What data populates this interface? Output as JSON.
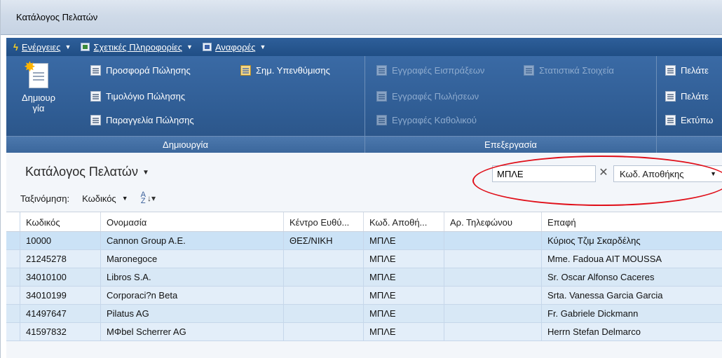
{
  "window": {
    "title": "Κατάλογος Πελατών"
  },
  "menubar": {
    "items": [
      {
        "label": "Ενέργειες",
        "icon": "lightning-icon"
      },
      {
        "label": "Σχετικές Πληροφορίες",
        "icon": "related-info-icon"
      },
      {
        "label": "Αναφορές",
        "icon": "reports-icon"
      }
    ]
  },
  "ribbon": {
    "create_group": {
      "label": "Δημιουργία",
      "new_button": "Δημιουργία",
      "items": [
        "Προσφορά Πώλησης",
        "Τιμολόγιο Πώλησης",
        "Παραγγελία Πώλησης",
        "Σημ. Υπενθύμισης"
      ]
    },
    "process_group": {
      "label": "Επεξεργασία",
      "items": [
        "Εγγραφές Εισπράξεων",
        "Εγγραφές Πωλήσεων",
        "Εγγραφές Καθολικού",
        "Στατιστικά Στοιχεία"
      ]
    },
    "report_group": {
      "items": [
        "Πελάτε",
        "Πελάτε",
        "Εκτύπω"
      ]
    }
  },
  "page": {
    "title": "Κατάλογος Πελατών",
    "sort_label": "Ταξινόμηση:",
    "sort_value": "Κωδικός",
    "sort_icon": "sort-ascending-icon"
  },
  "filter": {
    "value": "ΜΠΛΕ",
    "field": "Κωδ. Αποθήκης",
    "highlight_color": "#e0101a"
  },
  "table": {
    "columns": [
      "Κωδικός",
      "Ονομασία",
      "Κέντρο Ευθύ...",
      "Κωδ. Αποθή...",
      "Αρ. Τηλεφώνου",
      "Επαφή"
    ],
    "rows": [
      {
        "code": "10000",
        "name": "Cannon Group A.E.",
        "center": "ΘΕΣ/ΝΙΚΗ",
        "location": "ΜΠΛΕ",
        "phone": "",
        "contact": "Κύριος Τζιμ Σκαρδέλης"
      },
      {
        "code": "21245278",
        "name": "Maronegoce",
        "center": "",
        "location": "ΜΠΛΕ",
        "phone": "",
        "contact": "Mme. Fadoua AIT MOUSSA"
      },
      {
        "code": "34010100",
        "name": "Libros S.A.",
        "center": "",
        "location": "ΜΠΛΕ",
        "phone": "",
        "contact": "Sr. Oscar Alfonso Caceres"
      },
      {
        "code": "34010199",
        "name": "Corporaci?n Beta",
        "center": "",
        "location": "ΜΠΛΕ",
        "phone": "",
        "contact": "Srta. Vanessa Garcia Garcia"
      },
      {
        "code": "41497647",
        "name": "Pilatus AG",
        "center": "",
        "location": "ΜΠΛΕ",
        "phone": "",
        "contact": "Fr. Gabriele Dickmann"
      },
      {
        "code": "41597832",
        "name": "MΦbel Scherrer AG",
        "center": "",
        "location": "ΜΠΛΕ",
        "phone": "",
        "contact": "Herrn Stefan Delmarco"
      }
    ]
  }
}
